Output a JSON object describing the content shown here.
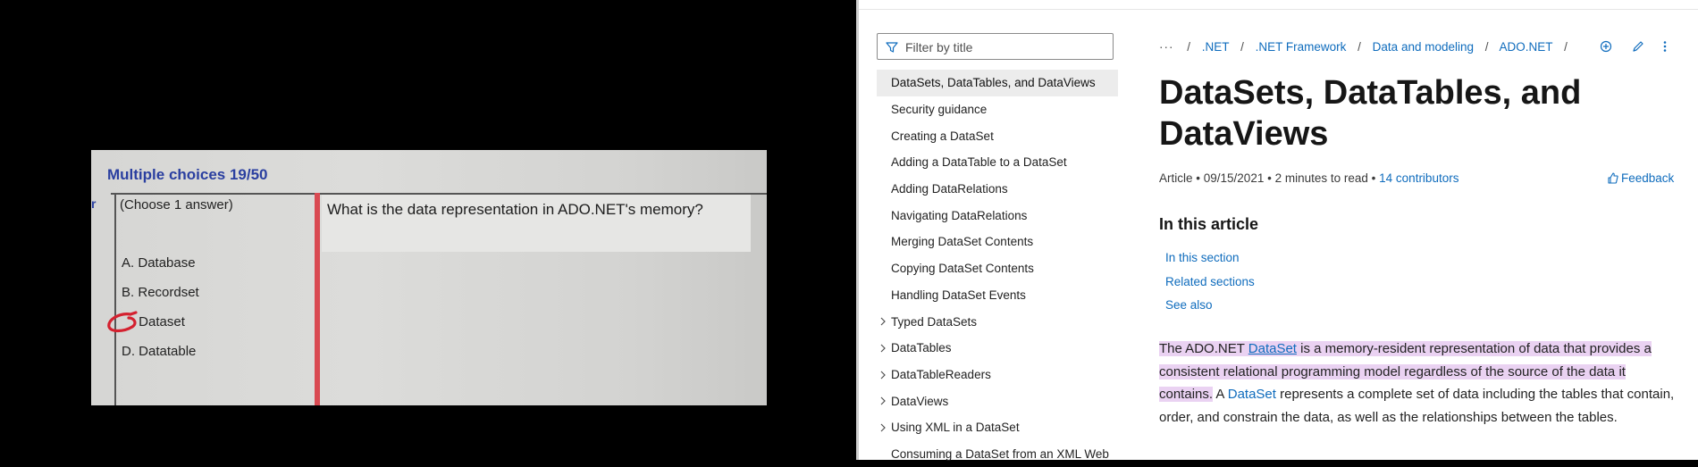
{
  "photo": {
    "title": "Multiple choices 19/50",
    "edge_letter": "r",
    "instruction": "(Choose 1 answer)",
    "question": "What is the data representation in ADO.NET's memory?",
    "options": [
      {
        "letter": "A.",
        "text": "Database"
      },
      {
        "letter": "B.",
        "text": "Recordset"
      },
      {
        "letter": "C.",
        "text": "Dataset"
      },
      {
        "letter": "D.",
        "text": "Datatable"
      }
    ]
  },
  "sidebar": {
    "filter_placeholder": "Filter by title",
    "items": [
      {
        "label": "DataSets, DataTables, and DataViews",
        "active": true,
        "expandable": false
      },
      {
        "label": "Security guidance",
        "active": false,
        "expandable": false
      },
      {
        "label": "Creating a DataSet",
        "active": false,
        "expandable": false
      },
      {
        "label": "Adding a DataTable to a DataSet",
        "active": false,
        "expandable": false
      },
      {
        "label": "Adding DataRelations",
        "active": false,
        "expandable": false
      },
      {
        "label": "Navigating DataRelations",
        "active": false,
        "expandable": false
      },
      {
        "label": "Merging DataSet Contents",
        "active": false,
        "expandable": false
      },
      {
        "label": "Copying DataSet Contents",
        "active": false,
        "expandable": false
      },
      {
        "label": "Handling DataSet Events",
        "active": false,
        "expandable": false
      },
      {
        "label": "Typed DataSets",
        "active": false,
        "expandable": true
      },
      {
        "label": "DataTables",
        "active": false,
        "expandable": true
      },
      {
        "label": "DataTableReaders",
        "active": false,
        "expandable": true
      },
      {
        "label": "DataViews",
        "active": false,
        "expandable": true
      },
      {
        "label": "Using XML in a DataSet",
        "active": false,
        "expandable": true
      },
      {
        "label": "Consuming a DataSet from an XML Web",
        "active": false,
        "expandable": false
      }
    ]
  },
  "breadcrumb": {
    "ellipsis": "···",
    "items": [
      ".NET",
      ".NET Framework",
      "Data and modeling",
      "ADO.NET"
    ]
  },
  "article": {
    "title": "DataSets, DataTables, and DataViews",
    "type": "Article",
    "date": "09/15/2021",
    "read_time": "2 minutes to read",
    "contributors": "14 contributors",
    "feedback": "Feedback",
    "in_this_article_heading": "In this article",
    "in_this_article_links": [
      "In this section",
      "Related sections",
      "See also"
    ],
    "para": {
      "p1": "The ADO.NET ",
      "link1": "DataSet",
      "p2": " is a memory-resident representation of data that provides a consistent relational programming model regardless of the source of the data it contains.",
      "p3": " A ",
      "link2": "DataSet",
      "p4": " represents a complete set of data including the tables that contain, order, and constrain the data, as well as the relationships between the tables."
    }
  },
  "colors": {
    "link": "#0f6cbd",
    "highlight": "#ead2f2",
    "annotation_red": "#d94a52",
    "photo_title": "#2a3fa0"
  },
  "icons": {
    "filter": "filter-icon",
    "add_collection": "add-circle-icon",
    "edit": "pencil-icon",
    "more": "more-vertical-icon",
    "feedback": "thumbs-up-icon",
    "expand": "chevron-right-icon"
  }
}
